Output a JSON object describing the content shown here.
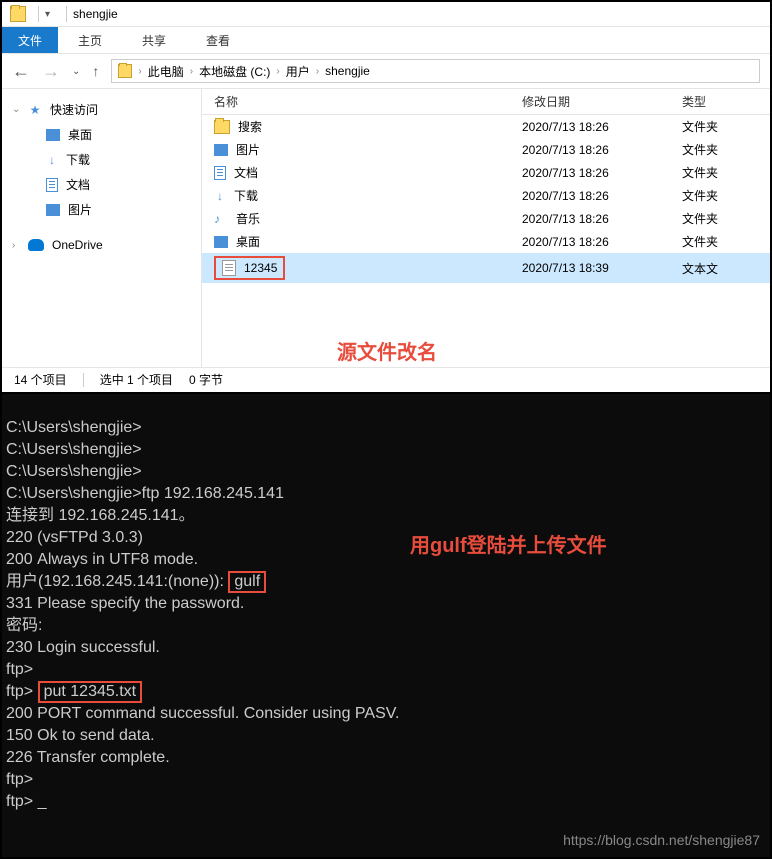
{
  "title": "shengjie",
  "ribbon": {
    "file": "文件",
    "home": "主页",
    "share": "共享",
    "view": "查看"
  },
  "breadcrumb": [
    "此电脑",
    "本地磁盘 (C:)",
    "用户",
    "shengjie"
  ],
  "sidebar": {
    "quick": "快速访问",
    "items": [
      "桌面",
      "下载",
      "文档",
      "图片"
    ],
    "onedrive": "OneDrive"
  },
  "columns": {
    "name": "名称",
    "date": "修改日期",
    "type": "类型"
  },
  "rows": [
    {
      "icon": "folder",
      "name": "搜索",
      "date": "2020/7/13 18:26",
      "type": "文件夹"
    },
    {
      "icon": "pic",
      "name": "图片",
      "date": "2020/7/13 18:26",
      "type": "文件夹"
    },
    {
      "icon": "doc",
      "name": "文档",
      "date": "2020/7/13 18:26",
      "type": "文件夹"
    },
    {
      "icon": "dl",
      "name": "下载",
      "date": "2020/7/13 18:26",
      "type": "文件夹"
    },
    {
      "icon": "music",
      "name": "音乐",
      "date": "2020/7/13 18:26",
      "type": "文件夹"
    },
    {
      "icon": "desk",
      "name": "桌面",
      "date": "2020/7/13 18:26",
      "type": "文件夹"
    },
    {
      "icon": "txt",
      "name": "12345",
      "date": "2020/7/13 18:39",
      "type": "文本文"
    }
  ],
  "status": {
    "count": "14 个项目",
    "sel": "选中 1 个项目",
    "size": "0 字节"
  },
  "annot1": "源文件改名",
  "annot2": "用gulf登陆并上传文件",
  "term": {
    "l1": "C:\\Users\\shengjie>",
    "l2": "C:\\Users\\shengjie>",
    "l3": "C:\\Users\\shengjie>",
    "l4a": "C:\\Users\\shengjie>",
    "l4b": "ftp 192.168.245.141",
    "l5": "连接到 192.168.245.141。",
    "l6": "220 (vsFTPd 3.0.3)",
    "l7": "200 Always in UTF8 mode.",
    "l8a": "用户(192.168.245.141:(none)): ",
    "l8b": "gulf",
    "l9": "331 Please specify the password.",
    "l10": "密码: ",
    "l11": "230 Login successful.",
    "l12": "ftp>",
    "l13a": "ftp> ",
    "l13b": "put 12345.txt",
    "l14": "200 PORT command successful. Consider using PASV.",
    "l15": "150 Ok to send data.",
    "l16": "226 Transfer complete.",
    "l17": "ftp>",
    "l18": "ftp> _"
  },
  "watermark": "https://blog.csdn.net/shengjie87"
}
